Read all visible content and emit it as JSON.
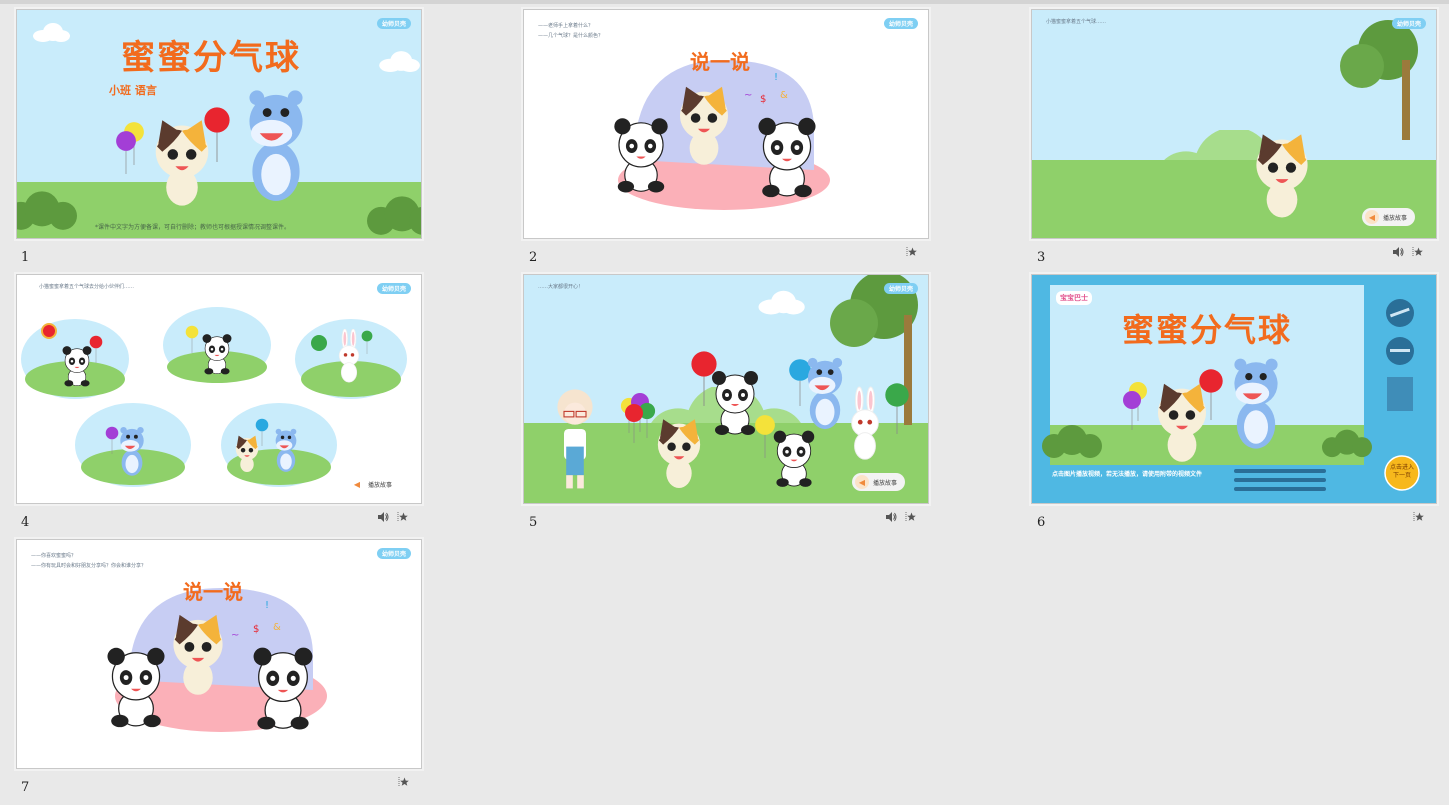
{
  "slides": [
    {
      "number": "1",
      "title": "蜜蜜分气球",
      "subtitle": "小班 语言",
      "note": "*课件中文字为方便备课，可自行删除；教师也可根据授课情况调整课件。",
      "logo": "幼师贝壳"
    },
    {
      "number": "2",
      "lines": [
        "——老师手上拿着什么？",
        "——几个气球？是什么颜色？"
      ],
      "heading": "说一说",
      "logo": "幼师贝壳"
    },
    {
      "number": "3",
      "story": "小猫蜜蜜拿着五个气球……",
      "play_label": "播放故事",
      "logo": "幼师贝壳"
    },
    {
      "number": "4",
      "story": "小猫蜜蜜拿着五个气球去分给小伙伴们……",
      "play_label": "播放故事",
      "logo": "幼师贝壳"
    },
    {
      "number": "5",
      "story": "……大家都很开心！",
      "play_label": "播放故事",
      "logo": "幼师贝壳"
    },
    {
      "number": "6",
      "title": "蜜蜜分气球",
      "instruction": "点击图片播放视频，若无法播放，请使用附带的视频文件",
      "next_label": "点击进入",
      "next_sub": "下一页",
      "brand": "宝宝巴士"
    },
    {
      "number": "7",
      "lines": [
        "——你喜欢蜜蜜吗？",
        "——你有玩具时会和好朋友分享吗？你会和谁分享？"
      ],
      "heading": "说一说",
      "logo": "幼师贝壳"
    }
  ],
  "icons": {
    "sound": "speaker-icon",
    "star": "star-icon"
  },
  "colors": {
    "sky": "#c9ecfb",
    "grass": "#8fd06a",
    "title_orange": "#f26b1d",
    "bg": "#e9e9e9",
    "slide6_frame": "#4fb8e3"
  }
}
